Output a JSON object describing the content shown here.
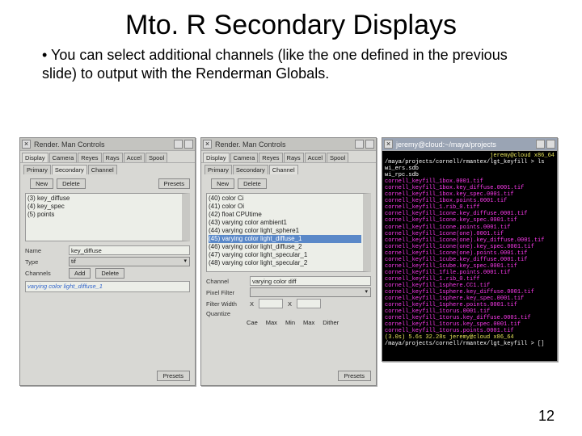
{
  "slide": {
    "title": "Mto. R Secondary Displays",
    "bullet": "You can select additional channels (like the one defined in the previous slide) to output with the Renderman Globals.",
    "page_number": "12"
  },
  "win_a": {
    "title": "Render. Man Controls",
    "tabs": [
      "Display",
      "Camera",
      "Reyes",
      "Rays",
      "Accel",
      "Spool"
    ],
    "subtabs": [
      "Primary",
      "Secondary",
      "Channel"
    ],
    "toolbar_label": "",
    "btn_new": "New",
    "btn_delete": "Delete",
    "btn_presets": "Presets",
    "list": [
      "(3) key_diffuse",
      "(4) key_spec",
      "(5) points"
    ],
    "fld_name_label": "Name",
    "fld_name_value": "key_diffuse",
    "fld_type_label": "Type",
    "fld_type_value": "tif",
    "fld_chan_label": "Channels",
    "btn_add": "Add",
    "btn_del2": "Delete",
    "output_line": "varying color light_diffuse_1",
    "footer": "Presets"
  },
  "win_b": {
    "title": "Render. Man Controls",
    "tabs": [
      "Display",
      "Camera",
      "Reyes",
      "Rays",
      "Accel",
      "Spool"
    ],
    "subtabs": [
      "Primary",
      "Secondary",
      "Channel"
    ],
    "btn_new": "New",
    "btn_delete": "Delete",
    "list": [
      "(40) color Ci",
      "(41) color Oi",
      "(42) float CPUtime",
      "(43) varying color ambient1",
      "(44) varying color light_sphere1",
      "(45) varying color light_diffuse_1",
      "(46) varying color light_diffuse_2",
      "(47) varying color light_specular_1",
      "(48) varying color light_specular_2"
    ],
    "selected_index": 5,
    "fld_chan_label": "Channel",
    "fld_chan_value": "varying color diff",
    "fld_pixfilter_label": "Pixel Filter",
    "fld_filterw_label": "Filter Width",
    "pf_x": "X",
    "pf_x_val": "",
    "pf_y": "X",
    "pf_y_val": "",
    "fld_quant_label": "Quantize",
    "q_labels": [
      "Cae",
      "Max",
      "Min",
      "Max",
      "Dither"
    ],
    "footer": "Presets"
  },
  "terminal": {
    "title": "jeremy@cloud:~/maya/projects",
    "prompt_host": "jeremy@cloud x86_64",
    "prompt_path": "/maya/projects/cornell/rmantex/lgt_keyfill > ls",
    "files_white": [
      "wi_ers.sdb",
      "wi_rpc.sdb"
    ],
    "lines": [
      "cornell_keyfill_1box.0001.tif",
      "cornell_keyfill_1box.key_diffuse.0001.tif",
      "cornell_keyfill_1box.key_spec.0001.tif",
      "cornell_keyfill_1box.points.0001.tif",
      "cornell_keyfill_1.rib_0.tiff",
      "cornell_keyfill_1cone.key_diffuse.0001.tif",
      "cornell_keyfill_1cone.key_spec.0001.tif",
      "cornell_keyfill_1cone.points.0001.tif",
      "cornell_keyfill_1cone(one).0001.tif",
      "cornell_keyfill_1cone(one).key_diffuse.0001.tif",
      "cornell_keyfill_1cone(one).key_spec.0001.tif",
      "cornell_keyfill_1cone(one).points.0001.tif",
      "cornell_keyfill_1cube.key_diffuse.0001.tif",
      "cornell_keyfill_1cube.key_spec.0001.tif",
      "cornell_keyfill_1file.points.0001.tif",
      "cornell_keyfill_1.rib_0.tiff",
      "cornell_keyfill_1sphere.CC1.tif",
      "cornell_keyfill_1sphere.key_diffuse.0001.tif",
      "cornell_keyfill_1sphere.key_spec.0001.tif",
      "cornell_keyfill_1sphere.points.0001.tif",
      "cornell_keyfill_1torus.0001.tif",
      "cornell_keyfill_1torus.key_diffuse.0001.tif",
      "cornell_keyfill_1torus.key_spec.0001.tif",
      "cornell_keyfill_1torus.points.0001.tif"
    ],
    "time_line": "(3.0s) 5.6s 32.28s  jeremy@cloud x86_64",
    "prompt2": "/maya/projects/cornell/rmantex/lgt_keyfill > []"
  }
}
